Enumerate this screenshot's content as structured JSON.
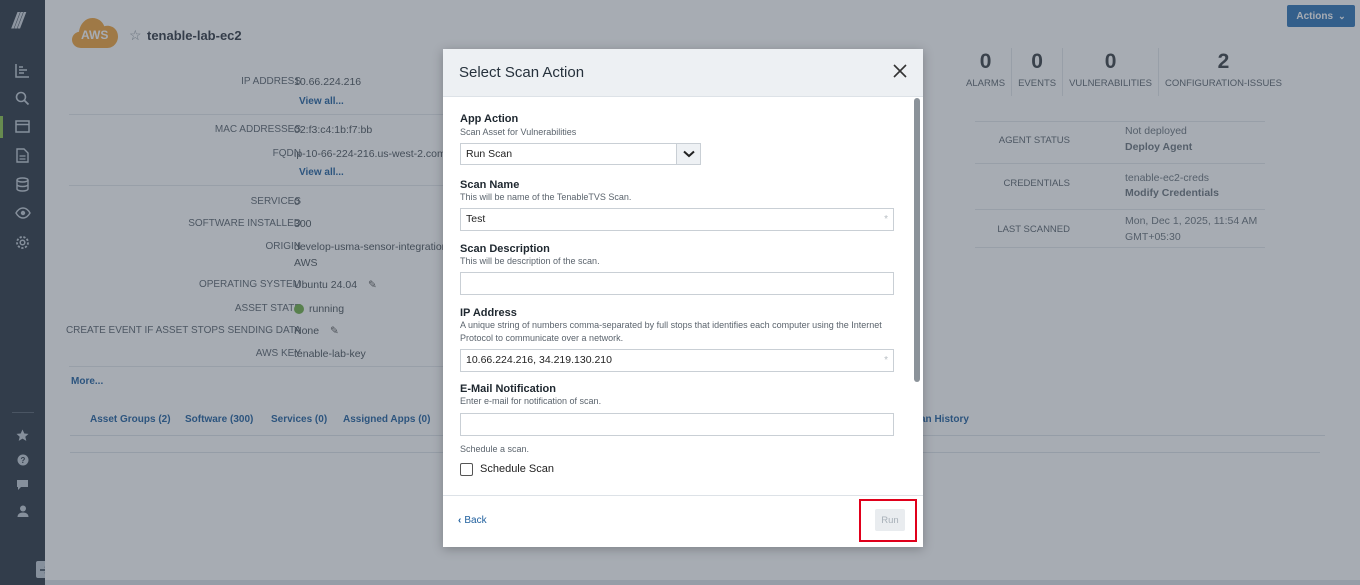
{
  "header": {
    "asset_name": "tenable-lab-ec2",
    "aws_badge": "AWS",
    "actions_label": "Actions"
  },
  "details": {
    "ip_address_label": "IP ADDRESS",
    "ip_address_value": "10.66.224.216",
    "view_all_1": "View all...",
    "mac_label": "MAC ADDRESSES",
    "mac_value": "02:f3:c4:1b:f7:bb",
    "fqdn_label": "FQDN",
    "fqdn_value": "ip-10-66-224-216.us-west-2.comp",
    "view_all_2": "View all...",
    "services_label": "SERVICES",
    "services_value": "0",
    "software_label": "SOFTWARE INSTALLED",
    "software_value": "300",
    "origin_label": "ORIGIN",
    "origin_value": "develop-usma-sensor-integration",
    "origin_value2": "AWS",
    "os_label": "OPERATING SYSTEM",
    "os_value": "Ubuntu 24.04",
    "state_label": "ASSET STATE",
    "state_value": "running",
    "create_event_label": "CREATE EVENT IF ASSET STOPS SENDING DATA",
    "create_event_value": "None",
    "aws_key_label": "AWS KEY",
    "aws_key_value": "tenable-lab-key",
    "more_link": "More..."
  },
  "counts": [
    {
      "num": "0",
      "label": "ALARMS"
    },
    {
      "num": "0",
      "label": "EVENTS"
    },
    {
      "num": "0",
      "label": "VULNERABILITIES"
    },
    {
      "num": "2",
      "label": "CONFIGURATION-ISSUES"
    }
  ],
  "info": {
    "agent_status_label": "AGENT STATUS",
    "agent_status_value": "Not deployed",
    "deploy_agent": "Deploy Agent",
    "credentials_label": "CREDENTIALS",
    "credentials_value": "tenable-ec2-creds",
    "modify_credentials": "Modify Credentials",
    "last_scanned_label": "LAST SCANNED",
    "last_scanned_value": "Mon, Dec 1, 2025, 11:54 AM",
    "last_scanned_tz": "GMT+05:30"
  },
  "tabs": [
    "Asset Groups (2)",
    "Software (300)",
    "Services (0)",
    "Assigned Apps (0)",
    "an History"
  ],
  "modal": {
    "title": "Select Scan Action",
    "app_action_title": "App Action",
    "app_action_help": "Scan Asset for Vulnerabilities",
    "app_action_value": "Run Scan",
    "scan_name_title": "Scan Name",
    "scan_name_help": "This will be name of the TenableTVS Scan.",
    "scan_name_value": "Test",
    "scan_desc_title": "Scan Description",
    "scan_desc_help": "This will be description of the scan.",
    "scan_desc_value": "",
    "ip_title": "IP Address",
    "ip_help": "A unique string of numbers comma-separated by full stops that identifies each computer using the Internet Protocol to communicate over a network.",
    "ip_value": "10.66.224.216, 34.219.130.210",
    "email_title": "E-Mail Notification",
    "email_help": "Enter e-mail for notification of scan.",
    "email_value": "",
    "schedule_help": "Schedule a scan.",
    "schedule_label": "Schedule Scan",
    "required_mark": "*",
    "back_label": "Back",
    "run_label": "Run"
  }
}
